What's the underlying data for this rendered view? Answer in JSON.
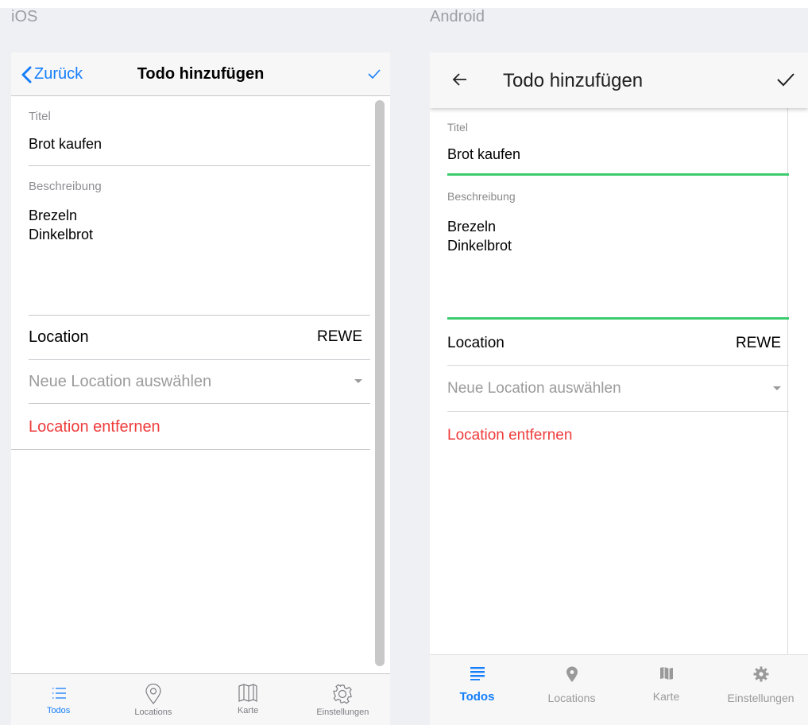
{
  "platforms": {
    "ios": "iOS",
    "android": "Android"
  },
  "ios": {
    "nav": {
      "back_label": "Zurück",
      "title": "Todo hinzufügen"
    },
    "form": {
      "title_label": "Titel",
      "title_value": "Brot kaufen",
      "description_label": "Beschreibung",
      "description_lines": [
        "Brezeln",
        "Dinkelbrot"
      ],
      "location_label": "Location",
      "location_value": "REWE",
      "select_placeholder": "Neue Location auswählen",
      "remove_label": "Location entfernen"
    },
    "tabs": [
      {
        "label": "Todos",
        "icon": "list-icon",
        "active": true
      },
      {
        "label": "Locations",
        "icon": "pin-icon",
        "active": false
      },
      {
        "label": "Karte",
        "icon": "map-icon",
        "active": false
      },
      {
        "label": "Einstellungen",
        "icon": "gear-icon",
        "active": false
      }
    ]
  },
  "android": {
    "appbar": {
      "title": "Todo hinzufügen"
    },
    "form": {
      "title_label": "Titel",
      "title_value": "Brot kaufen",
      "description_label": "Beschreibung",
      "description_lines": [
        "Brezeln",
        "Dinkelbrot"
      ],
      "location_label": "Location",
      "location_value": "REWE",
      "select_placeholder": "Neue Location auswählen",
      "remove_label": "Location entfernen"
    },
    "tabs": [
      {
        "label": "Todos",
        "icon": "list-icon",
        "active": true
      },
      {
        "label": "Locations",
        "icon": "pin-icon",
        "active": false
      },
      {
        "label": "Karte",
        "icon": "map-icon",
        "active": false
      },
      {
        "label": "Einstellungen",
        "icon": "gear-icon",
        "active": false
      }
    ]
  },
  "colors": {
    "ios_accent": "#147efb",
    "android_accent": "#3ccc6e",
    "danger": "#ee3b3b"
  }
}
